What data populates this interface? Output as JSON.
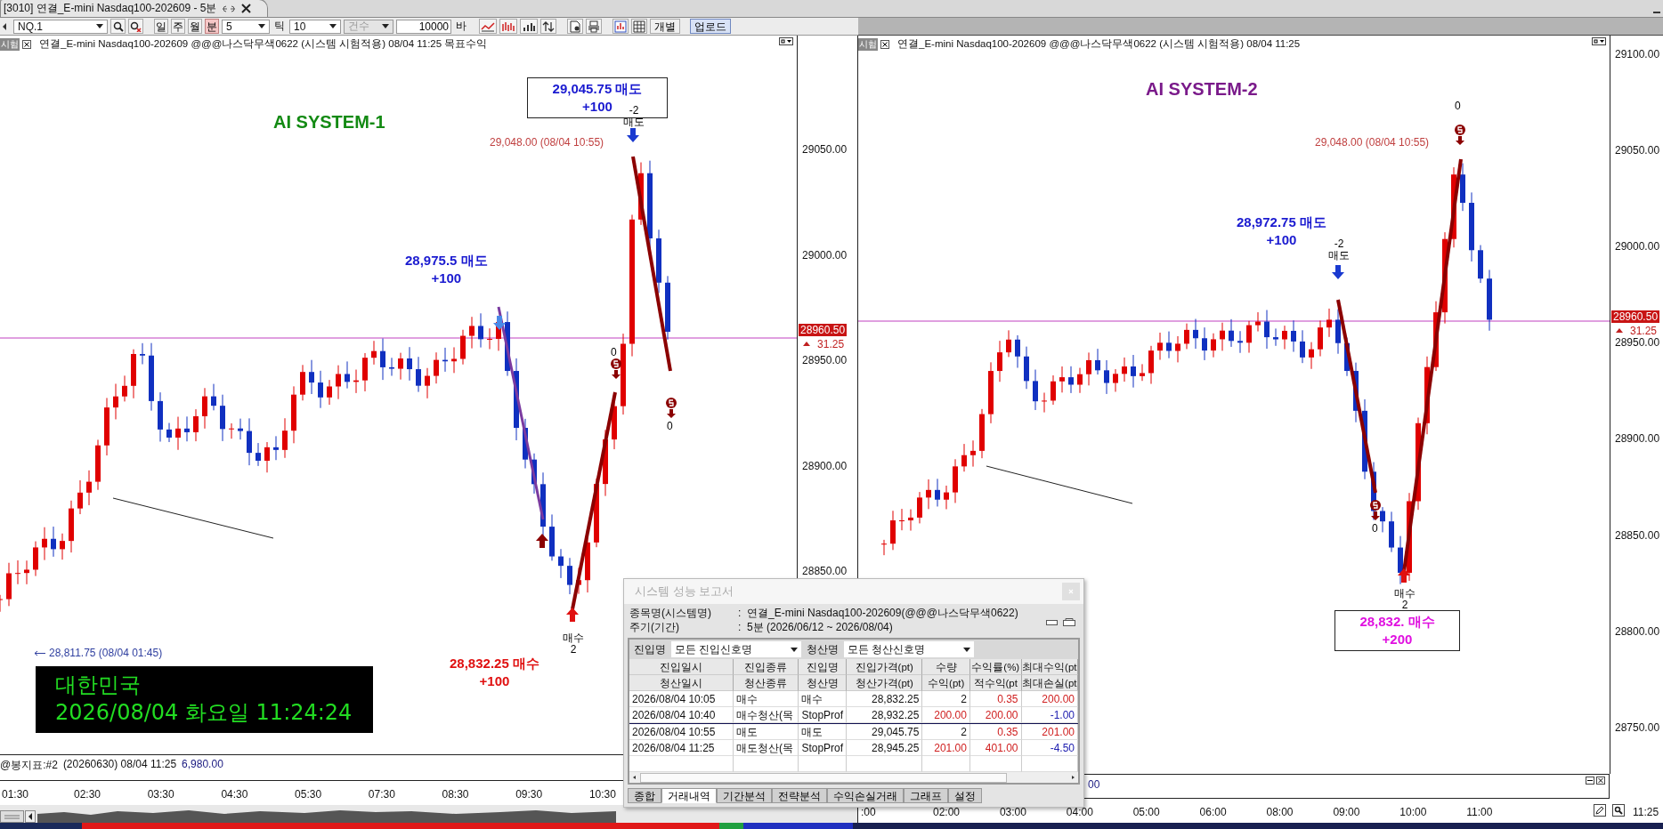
{
  "tab": {
    "title": "[3010] 연결_E-mini Nasdaq100-202609 - 5분"
  },
  "toolbar": {
    "symbol": "NQ.1",
    "periods": [
      {
        "label": "일",
        "selected": false
      },
      {
        "label": "주",
        "selected": false
      },
      {
        "label": "월",
        "selected": false
      },
      {
        "label": "분",
        "selected": true
      }
    ],
    "interval": "5",
    "tick_label": "틱",
    "tick_value": "10",
    "count_mode": {
      "label": "건수",
      "disabled": true
    },
    "bar_count": "10000",
    "bar_unit": "바",
    "buttons": [
      {
        "label": "개별",
        "highlighted": false
      },
      {
        "label": "업로드",
        "highlighted": true
      }
    ]
  },
  "charts": [
    {
      "badge": "시험",
      "title": "연결_E-mini Nasdaq100-202609 @@@나스닥무색0622 (시스템 시험적용) 08/04 11:25 목표수익",
      "system": {
        "label": "AI SYSTEM-1",
        "color": "#138a13"
      },
      "annotations": [
        {
          "kind": "box",
          "lines": [
            "29,045.75 매도",
            "+100"
          ],
          "color": "#1a1ad0"
        },
        {
          "kind": "note",
          "lines": [
            "-2",
            "매도"
          ]
        },
        {
          "kind": "note",
          "lines": [
            "29,048.00 (08/04 10:55)"
          ],
          "color": "#c04040"
        },
        {
          "kind": "callout",
          "lines": [
            "28,975.5 매도",
            "+100"
          ],
          "color": "#1a1ad0"
        },
        {
          "kind": "note",
          "lines": [
            "0"
          ]
        },
        {
          "kind": "note",
          "lines": [
            "0"
          ]
        },
        {
          "kind": "callout",
          "lines": [
            "28,832.25 매수",
            "+100"
          ],
          "color": "#e01010"
        },
        {
          "kind": "note",
          "lines": [
            "매수",
            "2"
          ]
        },
        {
          "kind": "low",
          "lines": [
            "28,811.75 (08/04 01:45)"
          ],
          "color": "#3040a0"
        },
        {
          "kind": "clock",
          "lines": [
            "대한민국",
            "2026/08/04 화요일 11:24:24"
          ],
          "color": "#22dd22"
        }
      ],
      "y_axis": [
        "29050.00",
        "29000.00",
        "28950.00",
        "28900.00",
        "28850.00"
      ],
      "price_tag": "28960.50",
      "price_change": "31.25",
      "indicator": {
        "name": "@봉지표:#2",
        "text": "(20260630) 08/04 11:25",
        "value": "6,980.00"
      },
      "x_axis": [
        "01:30",
        "02:30",
        "03:30",
        "04:30",
        "05:30",
        "07:30",
        "08:30",
        "09:30",
        "10:30"
      ]
    },
    {
      "badge": "시험",
      "title": "연결_E-mini Nasdaq100-202609 @@@나스닥무색0622 (시스템 시험적용) 08/04 11:25",
      "system": {
        "label": "AI SYSTEM-2",
        "color": "#7a1a8a"
      },
      "annotations": [
        {
          "kind": "note",
          "lines": [
            "29,048.00 (08/04 10:55)"
          ],
          "color": "#c04040"
        },
        {
          "kind": "note",
          "lines": [
            "0"
          ]
        },
        {
          "kind": "callout",
          "lines": [
            "28,972.75 매도",
            "+100"
          ],
          "color": "#1a1ad0"
        },
        {
          "kind": "note",
          "lines": [
            "-2",
            "매도"
          ]
        },
        {
          "kind": "note",
          "lines": [
            "0"
          ]
        },
        {
          "kind": "note",
          "lines": [
            "매수",
            "2"
          ]
        },
        {
          "kind": "box",
          "lines": [
            "28,832. 매수",
            "+200"
          ],
          "color": "#e010e0"
        }
      ],
      "y_axis": [
        "29100.00",
        "29050.00",
        "29000.00",
        "28950.00",
        "28900.00",
        "28850.00",
        "28800.00",
        "28750.00"
      ],
      "price_tag": "28960.50",
      "price_change": "31.25",
      "indicator": {
        "value": "00"
      },
      "x_axis": [
        ":00",
        "02:00",
        "03:00",
        "04:00",
        "05:00",
        "06:00",
        "08:00",
        "09:00",
        "10:00",
        "11:00"
      ],
      "x_end": "11:25"
    }
  ],
  "report": {
    "title": "시스템 성능 보고서",
    "colon": ":",
    "info": [
      {
        "label": "종목명(시스템명)",
        "value": "연결_E-mini Nasdaq100-202609(@@@나스닥무색0622)"
      },
      {
        "label": "주기(기간)",
        "value": "5분 (2026/06/12 ~ 2026/08/04)"
      }
    ],
    "filters": [
      {
        "label": "진입명",
        "value": "모든 진입신호명"
      },
      {
        "label": "청산명",
        "value": "모든 청산신호명"
      }
    ],
    "header_rows": [
      [
        "진입일시",
        "진입종류",
        "진입명",
        "진입가격(pt)",
        "수량",
        "수익률(%)",
        "최대수익(pt"
      ],
      [
        "청산일시",
        "청산종류",
        "청산명",
        "청산가격(pt)",
        "수익(pt)",
        "적수익(pt",
        "최대손실(pt"
      ]
    ],
    "trades": [
      {
        "rows": [
          [
            {
              "text": "2026/08/04 10:05"
            },
            {
              "text": "매수"
            },
            {
              "text": "매수"
            },
            {
              "text": "28,832.25"
            },
            {
              "text": "2"
            },
            {
              "text": "0.35",
              "color": "#d02020"
            },
            {
              "text": "200.00",
              "color": "#d02020"
            }
          ],
          [
            {
              "text": "2026/08/04 10:40"
            },
            {
              "text": "매수청산(목"
            },
            {
              "text": "StopProf"
            },
            {
              "text": "28,932.25"
            },
            {
              "text": "200.00",
              "color": "#d02020"
            },
            {
              "text": "200.00",
              "color": "#d02020"
            },
            {
              "text": "-1.00",
              "color": "#2020b0"
            }
          ]
        ]
      },
      {
        "rows": [
          [
            {
              "text": "2026/08/04 10:55"
            },
            {
              "text": "매도"
            },
            {
              "text": "매도"
            },
            {
              "text": "29,045.75"
            },
            {
              "text": "2"
            },
            {
              "text": "0.35",
              "color": "#d02020"
            },
            {
              "text": "201.00",
              "color": "#d02020"
            }
          ],
          [
            {
              "text": "2026/08/04 11:25"
            },
            {
              "text": "매도청산(목"
            },
            {
              "text": "StopProf"
            },
            {
              "text": "28,945.25"
            },
            {
              "text": "201.00",
              "color": "#d02020"
            },
            {
              "text": "401.00",
              "color": "#d02020"
            },
            {
              "text": "-4.50",
              "color": "#2020b0"
            }
          ]
        ]
      }
    ],
    "tabs": [
      {
        "label": "종합",
        "selected": false
      },
      {
        "label": "거래내역",
        "selected": true
      },
      {
        "label": "기간분석",
        "selected": false
      },
      {
        "label": "전략분석",
        "selected": false
      },
      {
        "label": "수익손실거래",
        "selected": false
      },
      {
        "label": "그래프",
        "selected": false
      },
      {
        "label": "설정",
        "selected": false
      }
    ]
  }
}
